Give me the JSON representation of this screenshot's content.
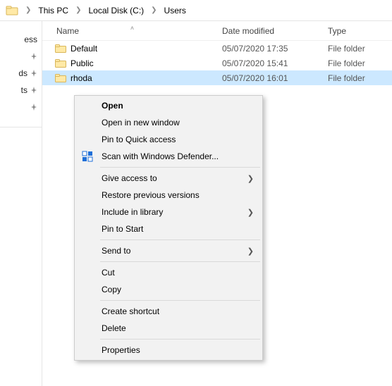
{
  "breadcrumb": {
    "items": [
      "This PC",
      "Local Disk (C:)",
      "Users"
    ]
  },
  "navpane": {
    "items": [
      {
        "label": "ess",
        "pinned": false
      },
      {
        "label": "",
        "pinned": true
      },
      {
        "label": "ds",
        "pinned": true
      },
      {
        "label": "ts",
        "pinned": true
      },
      {
        "label": "",
        "pinned": true
      }
    ]
  },
  "columns": {
    "name": "Name",
    "date": "Date modified",
    "type": "Type"
  },
  "rows": [
    {
      "name": "Default",
      "date": "05/07/2020 17:35",
      "type": "File folder",
      "selected": false
    },
    {
      "name": "Public",
      "date": "05/07/2020 15:41",
      "type": "File folder",
      "selected": false
    },
    {
      "name": "rhoda",
      "date": "05/07/2020 16:01",
      "type": "File folder",
      "selected": true
    }
  ],
  "context_menu": {
    "groups": [
      [
        {
          "label": "Open",
          "bold": true,
          "icon": null,
          "submenu": false
        },
        {
          "label": "Open in new window",
          "bold": false,
          "icon": null,
          "submenu": false
        },
        {
          "label": "Pin to Quick access",
          "bold": false,
          "icon": null,
          "submenu": false
        },
        {
          "label": "Scan with Windows Defender...",
          "bold": false,
          "icon": "defender",
          "submenu": false
        }
      ],
      [
        {
          "label": "Give access to",
          "bold": false,
          "icon": null,
          "submenu": true
        },
        {
          "label": "Restore previous versions",
          "bold": false,
          "icon": null,
          "submenu": false
        },
        {
          "label": "Include in library",
          "bold": false,
          "icon": null,
          "submenu": true
        },
        {
          "label": "Pin to Start",
          "bold": false,
          "icon": null,
          "submenu": false
        }
      ],
      [
        {
          "label": "Send to",
          "bold": false,
          "icon": null,
          "submenu": true
        }
      ],
      [
        {
          "label": "Cut",
          "bold": false,
          "icon": null,
          "submenu": false
        },
        {
          "label": "Copy",
          "bold": false,
          "icon": null,
          "submenu": false
        }
      ],
      [
        {
          "label": "Create shortcut",
          "bold": false,
          "icon": null,
          "submenu": false
        },
        {
          "label": "Delete",
          "bold": false,
          "icon": null,
          "submenu": false
        }
      ],
      [
        {
          "label": "Properties",
          "bold": false,
          "icon": null,
          "submenu": false
        }
      ]
    ]
  }
}
